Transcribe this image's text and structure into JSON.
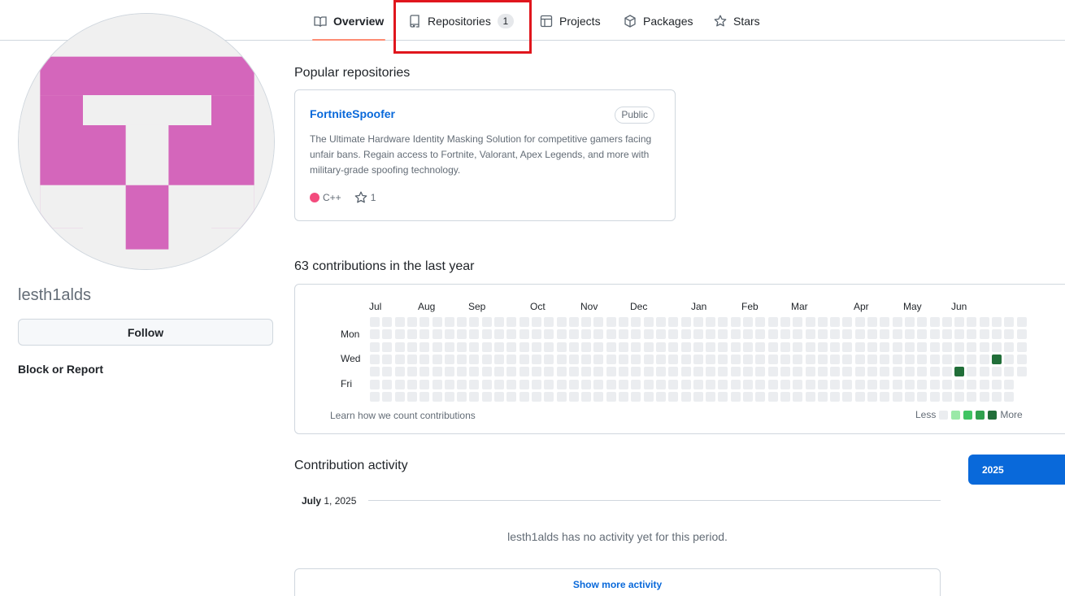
{
  "nav": {
    "tabs": [
      {
        "label": "Overview",
        "icon": "book-icon"
      },
      {
        "label": "Repositories",
        "icon": "repo-icon",
        "count": "1"
      },
      {
        "label": "Projects",
        "icon": "table-icon"
      },
      {
        "label": "Packages",
        "icon": "package-icon"
      },
      {
        "label": "Stars",
        "icon": "star-icon"
      }
    ],
    "active_tab": "Overview",
    "highlighted_tab": "Repositories"
  },
  "profile": {
    "username": "lesth1alds",
    "follow_label": "Follow",
    "block_label": "Block or Report",
    "avatar_color": "#d466bb"
  },
  "popular": {
    "title": "Popular repositories",
    "repos": [
      {
        "name": "FortniteSpoofer",
        "visibility": "Public",
        "description": "The Ultimate Hardware Identity Masking Solution for competitive gamers facing unfair bans. Regain access to Fortnite, Valorant, Apex Legends, and more with military-grade spoofing technology.",
        "language": "C++",
        "language_color": "#f34b7d",
        "stars": "1"
      }
    ]
  },
  "contributions": {
    "title": "63 contributions in the last year",
    "months": [
      "Jul",
      "Aug",
      "Sep",
      "Oct",
      "Nov",
      "Dec",
      "Jan",
      "Feb",
      "Mar",
      "Apr",
      "May",
      "Jun"
    ],
    "days": [
      "Mon",
      "Wed",
      "Fri"
    ],
    "learn_label": "Learn how we count contributions",
    "legend_less": "Less",
    "legend_more": "More",
    "legend_colors": [
      "#ebedf0",
      "#9be9a8",
      "#40c463",
      "#30a14e",
      "#216e39"
    ],
    "active_cells": [
      {
        "week": 47,
        "day": 4,
        "level": 4
      },
      {
        "week": 50,
        "day": 3,
        "level": 4
      }
    ]
  },
  "activity": {
    "title": "Contribution activity",
    "year": "2025",
    "month": "July",
    "date_rest": " 1, 2025",
    "empty_text": "lesth1alds has no activity yet for this period.",
    "show_more": "Show more activity"
  }
}
